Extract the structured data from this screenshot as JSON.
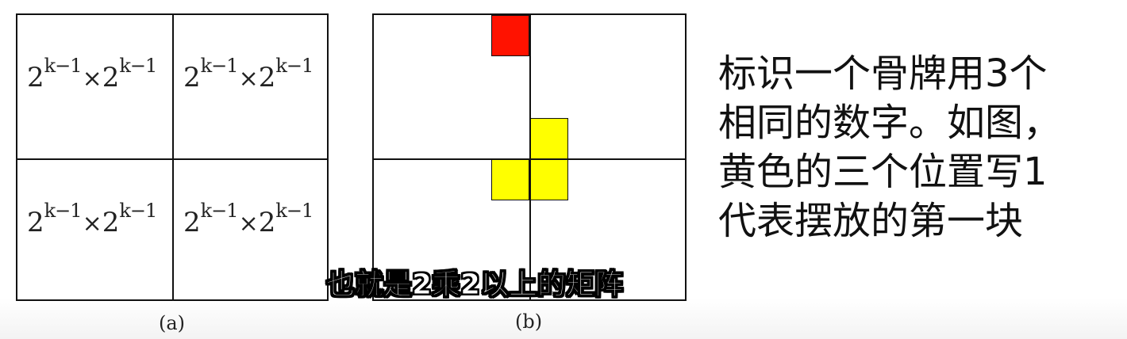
{
  "figure_a": {
    "label": "(a)",
    "cells": [
      {
        "base1": "2",
        "exp1": "k−1",
        "times": "×",
        "base2": "2",
        "exp2": "k−1"
      },
      {
        "base1": "2",
        "exp1": "k−1",
        "times": "×",
        "base2": "2",
        "exp2": "k−1"
      },
      {
        "base1": "2",
        "exp1": "k−1",
        "times": "×",
        "base2": "2",
        "exp2": "k−1"
      },
      {
        "base1": "2",
        "exp1": "k−1",
        "times": "×",
        "base2": "2",
        "exp2": "k−1"
      }
    ]
  },
  "figure_b": {
    "label": "(b)",
    "colors": {
      "special_square": "#ff1200",
      "l_tromino": "#ffff00"
    }
  },
  "caption": {
    "lines": [
      "标识一个骨牌用3个",
      "相同的数字。如图，",
      "黄色的三个位置写1",
      "代表摆放的第一块"
    ]
  },
  "subtitle": "也就是2乘2以上的矩阵"
}
